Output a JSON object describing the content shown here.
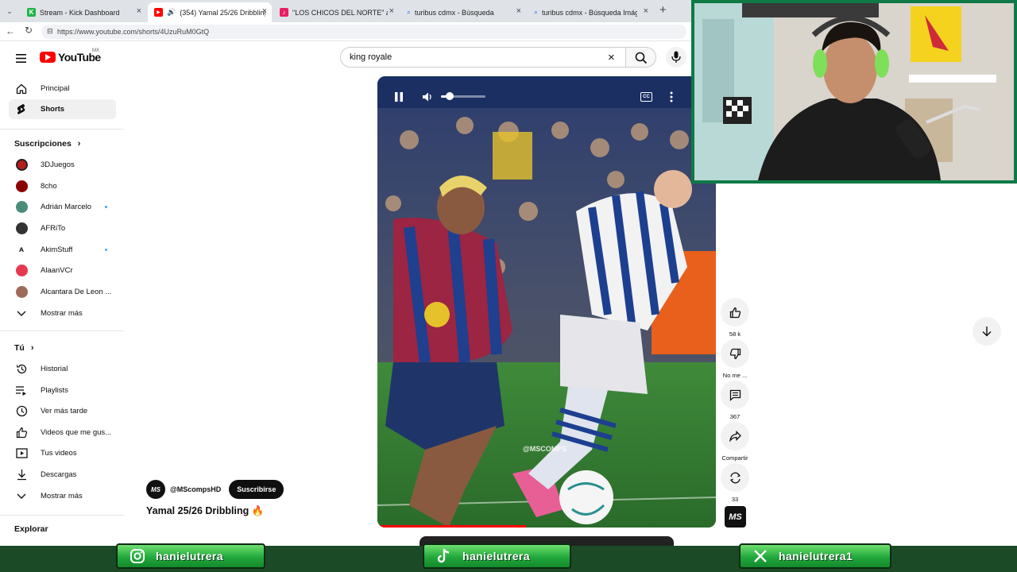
{
  "browser": {
    "tabs": [
      {
        "label": "Stream - Kick Dashboard",
        "fav_color": "#21b34a",
        "fav_glyph": "K",
        "active": false
      },
      {
        "label": "(354) Yamal 25/26 Dribbling",
        "fav_color": "#ff0000",
        "fav_glyph": "▶",
        "active": true
      },
      {
        "label": "\"LOS CHICOS DEL NORTE\" álbum",
        "fav_color": "#e91e63",
        "fav_glyph": "♪",
        "active": false
      },
      {
        "label": "turibus cdmx - Búsqueda",
        "fav_color": "#ffffff",
        "fav_glyph": "",
        "active": false
      },
      {
        "label": "turibus cdmx - Búsqueda Imágene",
        "fav_color": "#ffffff",
        "fav_glyph": "",
        "active": false
      }
    ],
    "new_tab": "+",
    "url": "https://www.youtube.com/shorts/4UzuRuM0GtQ"
  },
  "header": {
    "logo_text": "YouTube",
    "country": "MX",
    "search_value": "king royale"
  },
  "sidebar": {
    "main": [
      {
        "label": "Principal",
        "icon": "home-icon",
        "active": false
      },
      {
        "label": "Shorts",
        "icon": "shorts-icon",
        "active": true
      }
    ],
    "subscriptions_title": "Suscripciones",
    "subscriptions": [
      {
        "label": "3DJuegos",
        "color": "#b71c1c",
        "dot": false
      },
      {
        "label": "8cho",
        "color": "#8b0000",
        "dot": false
      },
      {
        "label": "Adrián Marcelo",
        "color": "#4a8c7a",
        "dot": true
      },
      {
        "label": "AFRiTo",
        "color": "#333333",
        "dot": false
      },
      {
        "label": "AkimStuff",
        "color": "#ffffff",
        "dot": true
      },
      {
        "label": "AlaanVCr",
        "color": "#e53950",
        "dot": false
      },
      {
        "label": "Alcantara De Leon ...",
        "color": "#9e6b5a",
        "dot": false
      },
      {
        "label": "Mostrar más",
        "color": "",
        "dot": false
      }
    ],
    "you_title": "Tú",
    "you": [
      {
        "label": "Historial",
        "icon": "history-icon"
      },
      {
        "label": "Playlists",
        "icon": "playlists-icon"
      },
      {
        "label": "Ver más tarde",
        "icon": "watch-later-icon"
      },
      {
        "label": "Videos que me gus...",
        "icon": "liked-videos-icon"
      },
      {
        "label": "Tus videos",
        "icon": "your-videos-icon"
      },
      {
        "label": "Descargas",
        "icon": "downloads-icon"
      },
      {
        "label": "Mostrar más",
        "icon": "chevron-down-icon"
      }
    ],
    "explore_title": "Explorar"
  },
  "short": {
    "channel_avatar": "MS",
    "channel": "@MScompsHD",
    "subscribe": "Suscribirse",
    "title": "Yamal 25/26 Dribbling 🔥",
    "watermark": "@MSCOMPS",
    "progress": 0.44
  },
  "actions": {
    "likes": "58 k",
    "dislike": "No me ...",
    "comments": "367",
    "share": "Compartir",
    "remix": "33"
  },
  "socials": [
    {
      "handle": "hanielutrera",
      "icon": "instagram-icon"
    },
    {
      "handle": "hanielutrera",
      "icon": "tiktok-icon"
    },
    {
      "handle": "hanielutrera1",
      "icon": "x-icon"
    }
  ],
  "colors": {
    "youtube_red": "#ff0000",
    "overlay_green": "#22a83c"
  }
}
